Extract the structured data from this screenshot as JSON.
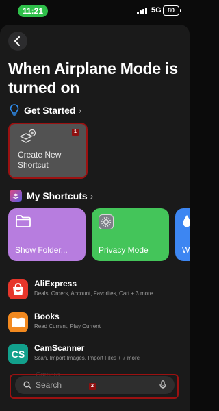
{
  "status_bar": {
    "time": "11:21",
    "network": "5G",
    "battery": "80"
  },
  "page": {
    "title": "When Airplane Mode is turned on"
  },
  "get_started": {
    "label": "Get Started",
    "chevron": "›",
    "create_card": {
      "label": "Create New Shortcut",
      "badge": "1"
    }
  },
  "my_shortcuts": {
    "label": "My Shortcuts",
    "chevron": "›",
    "cards": [
      {
        "label": "Show Folder...",
        "color": "#b77ddf",
        "icon": "folder-icon"
      },
      {
        "label": "Privacy Mode",
        "color": "#44c55a",
        "icon": "settings-icon"
      },
      {
        "label": "W",
        "color": "#3d86f2",
        "icon": "drop-icon"
      }
    ]
  },
  "apps": [
    {
      "name": "AliExpress",
      "desc": "Deals, Orders, Account, Favorites, Cart + 3 more",
      "icon": "aliexpress-icon"
    },
    {
      "name": "Books",
      "desc": "Read Current, Play Current",
      "icon": "books-icon"
    },
    {
      "name": "CamScanner",
      "desc": "Scan, Import Images, Import Files + 7 more",
      "icon": "camscanner-icon",
      "icon_text": "CS"
    }
  ],
  "search": {
    "placeholder": "Search",
    "badge": "2",
    "ghost_text": "Camera"
  }
}
